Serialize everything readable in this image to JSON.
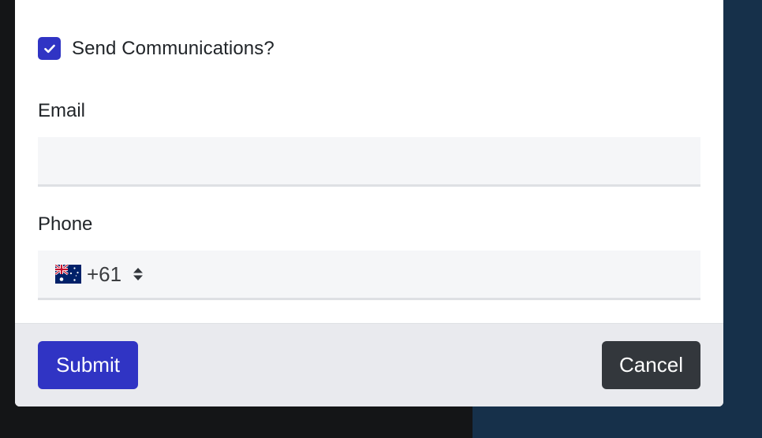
{
  "form": {
    "communications": {
      "label": "Send Communications?",
      "checked": true
    },
    "email": {
      "label": "Email",
      "value": ""
    },
    "phone": {
      "label": "Phone",
      "country_flag": "australia-flag-icon",
      "dial_code": "+61"
    }
  },
  "footer": {
    "submit_label": "Submit",
    "cancel_label": "Cancel"
  },
  "colors": {
    "primary": "#3034c4",
    "secondary": "#33373c",
    "backdrop_left": "#141517",
    "backdrop_right": "#16304a",
    "input_bg": "#f5f6f8",
    "footer_bg": "#e9eaee"
  },
  "icons": {
    "checkbox": "check-icon",
    "phone_selector": "sort-arrows-icon"
  }
}
